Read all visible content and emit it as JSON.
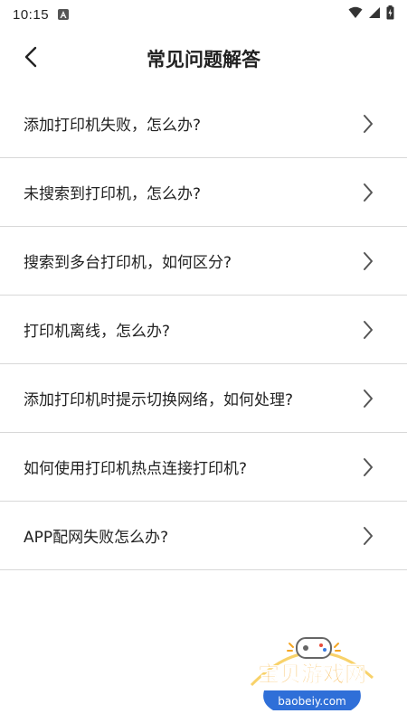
{
  "status_bar": {
    "time": "10:15",
    "icons": [
      "app-notification-icon",
      "wifi-icon",
      "signal-icon",
      "battery-charging-icon"
    ]
  },
  "header": {
    "title": "常见问题解答",
    "back_icon": "chevron-left-icon"
  },
  "faq": {
    "items": [
      {
        "label": "添加打印机失败，怎么办?"
      },
      {
        "label": "未搜索到打印机，怎么办?"
      },
      {
        "label": "搜索到多台打印机，如何区分?"
      },
      {
        "label": "打印机离线，怎么办?"
      },
      {
        "label": "添加打印机时提示切换网络，如何处理?"
      },
      {
        "label": "如何使用打印机热点连接打印机?"
      },
      {
        "label": "APP配网失败怎么办?"
      }
    ],
    "chevron_icon": "chevron-right-icon"
  },
  "watermark": {
    "brand": "宝贝游戏网",
    "url": "baobeiy.com",
    "colors": {
      "brand": "#f5a623",
      "badge": "#2f6fd8"
    }
  },
  "colors": {
    "divider": "#d8d8d8",
    "text": "#222222",
    "chevron": "#555555"
  }
}
